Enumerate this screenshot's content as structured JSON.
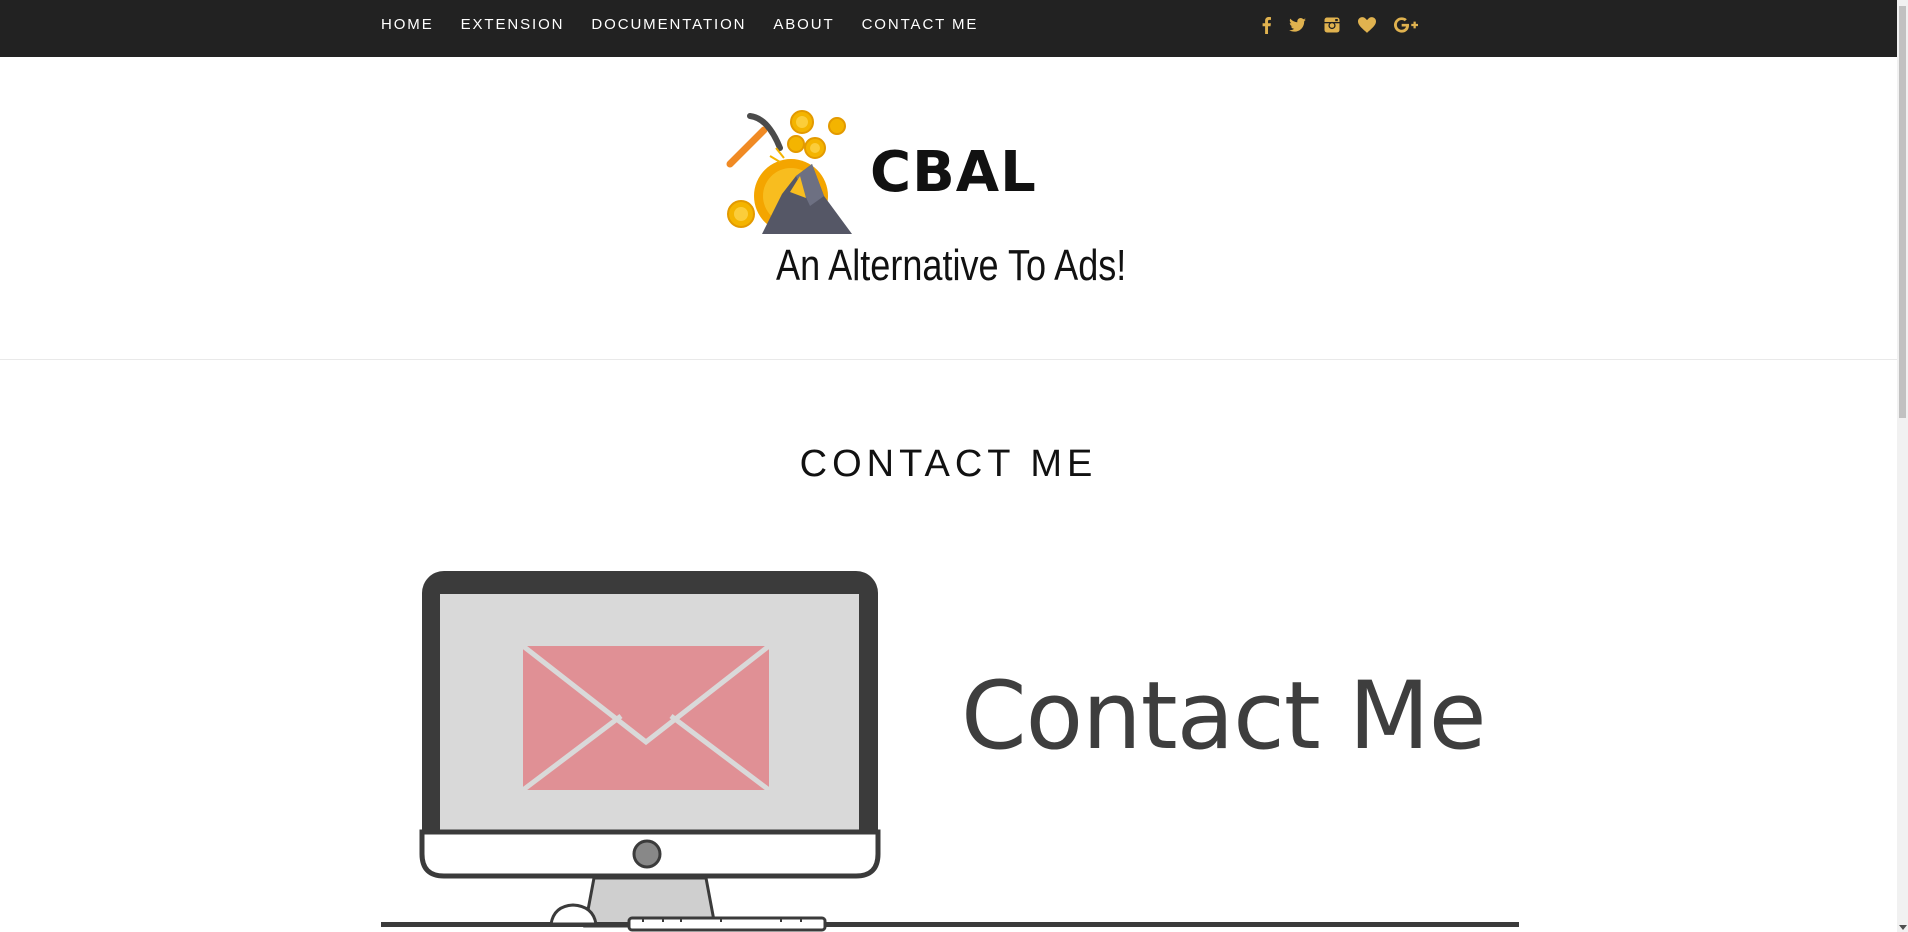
{
  "nav": {
    "items": [
      {
        "label": "HOME"
      },
      {
        "label": "EXTENSION"
      },
      {
        "label": "DOCUMENTATION"
      },
      {
        "label": "ABOUT"
      },
      {
        "label": "CONTACT ME"
      }
    ]
  },
  "social": {
    "icons": [
      "facebook-icon",
      "twitter-icon",
      "instagram-icon",
      "heart-icon",
      "google-plus-icon"
    ],
    "color": "#e0b24f"
  },
  "header": {
    "brand": "CBAL",
    "tagline": "An Alternative To Ads!"
  },
  "main": {
    "title": "CONTACT ME",
    "hero_text": "Contact Me"
  },
  "colors": {
    "topbar": "#222222",
    "accent": "#e0b24f",
    "envelope": "#e09095",
    "screen": "#d9d9d9",
    "monitor_frame": "#3b3b3b"
  }
}
